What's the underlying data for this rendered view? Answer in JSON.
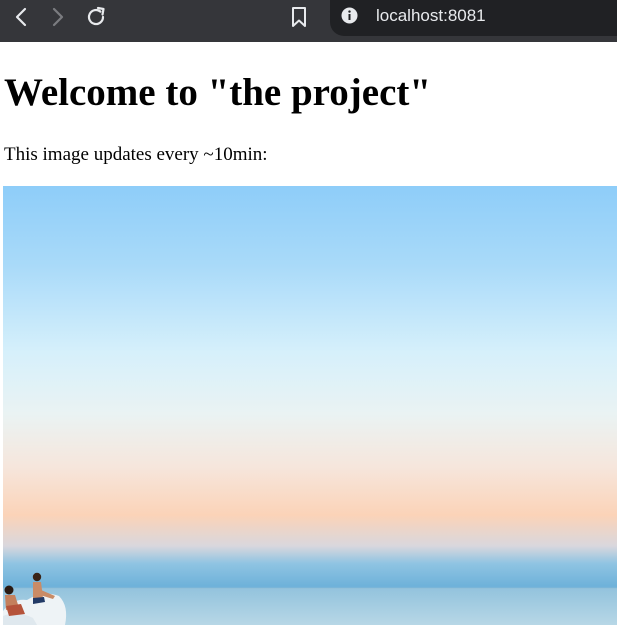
{
  "browser": {
    "address": "localhost:8081",
    "icons": {
      "back": "chevron-left-icon",
      "forward": "chevron-right-icon",
      "reload": "reload-icon",
      "bookmark": "bookmark-icon",
      "site_info": "info-icon"
    },
    "colors": {
      "toolbar": "#35363a",
      "address_bar": "#202124",
      "address_text": "#e8eaed"
    }
  },
  "page": {
    "heading": "Welcome to \"the project\"",
    "description": "This image updates every ~10min:"
  },
  "photo": {
    "colors": {
      "sky_top": "#8ecdf9",
      "sky_mid": "#d6f0fb",
      "horizon_glow": "#fbd3b8",
      "sea": "#7eb8d8"
    }
  }
}
